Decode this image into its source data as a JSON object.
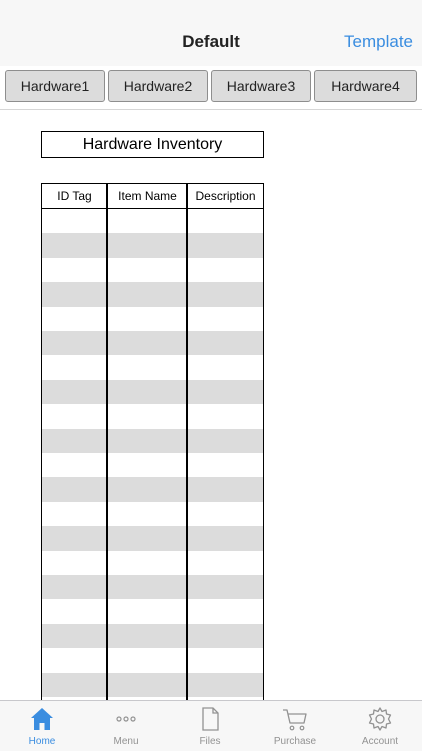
{
  "navbar": {
    "title": "Default",
    "action_label": "Template"
  },
  "tabs": [
    {
      "label": "Hardware1"
    },
    {
      "label": "Hardware2"
    },
    {
      "label": "Hardware3"
    },
    {
      "label": "Hardware4"
    }
  ],
  "document": {
    "title": "Hardware Inventory",
    "columns": [
      "ID Tag",
      "Item Name",
      "Description"
    ]
  },
  "tabbar": {
    "items": [
      {
        "label": "Home",
        "icon": "home-icon",
        "active": true
      },
      {
        "label": "Menu",
        "icon": "more-dots-icon",
        "active": false
      },
      {
        "label": "Files",
        "icon": "file-icon",
        "active": false
      },
      {
        "label": "Purchase",
        "icon": "cart-icon",
        "active": false
      },
      {
        "label": "Account",
        "icon": "gear-icon",
        "active": false
      }
    ],
    "active_color": "#3a8de0",
    "inactive_color": "#929292"
  },
  "colors": {
    "accent": "#3a8de0",
    "row_shade": "#dcdcdc"
  }
}
